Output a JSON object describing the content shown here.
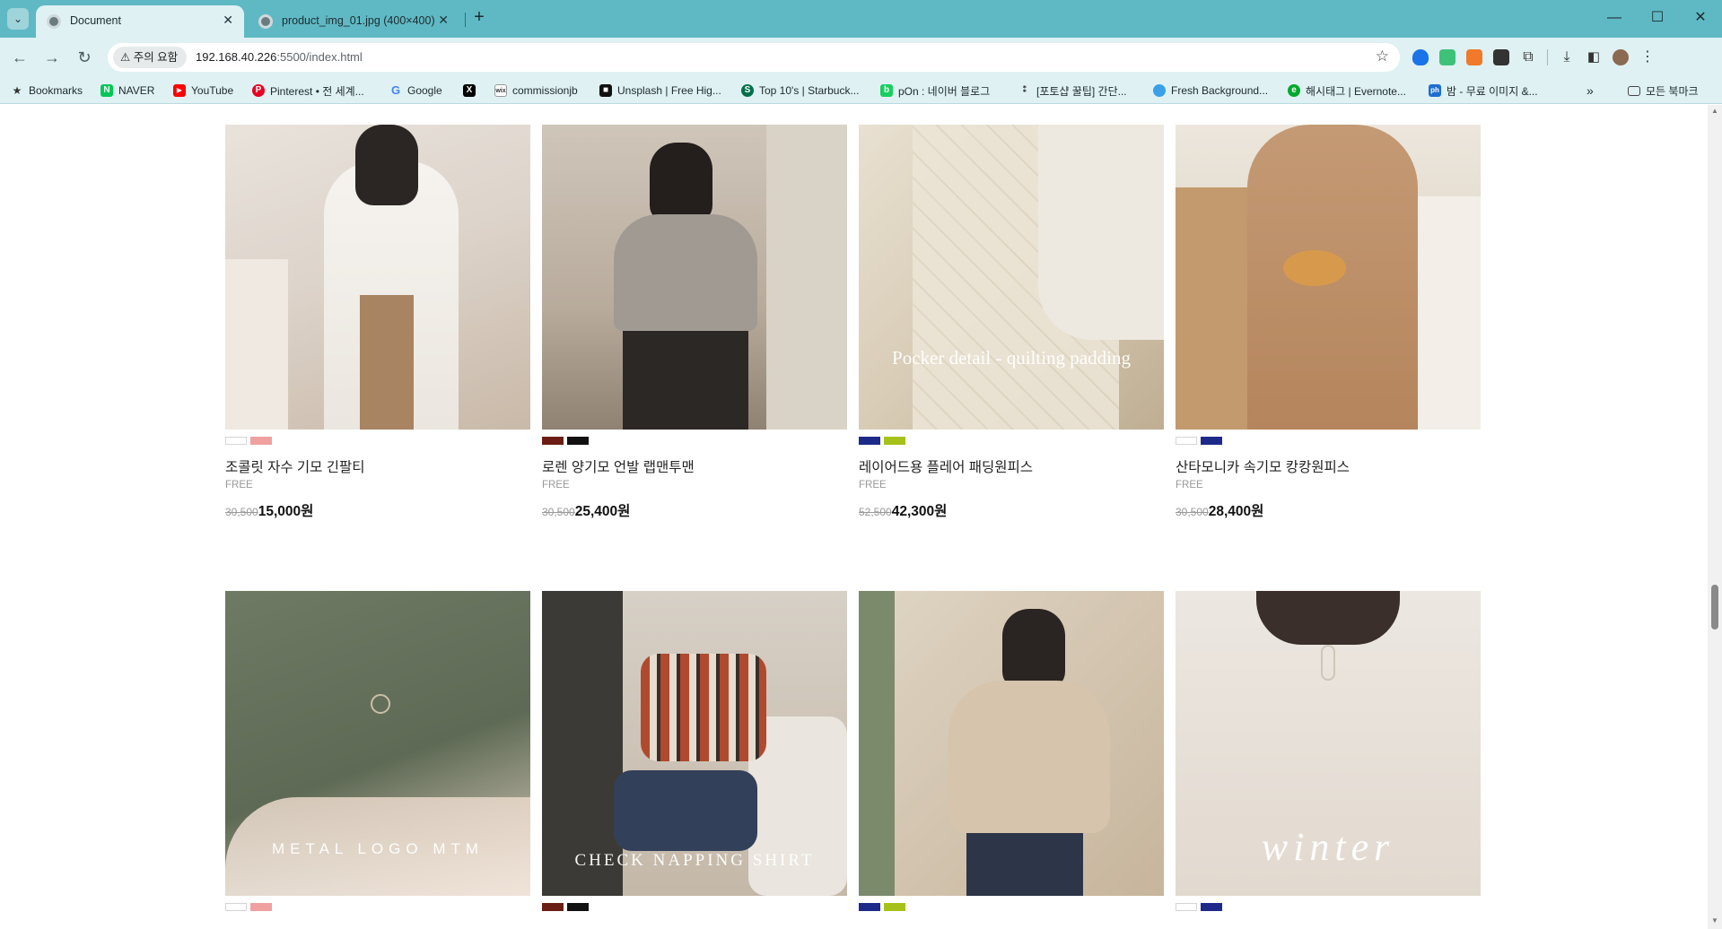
{
  "browser": {
    "tabs": [
      {
        "title": "Document",
        "active": true
      },
      {
        "title": "product_img_01.jpg (400×400)",
        "active": false
      }
    ],
    "security_label": "주의 요함",
    "url_host": "192.168.40.226",
    "url_rest": ":5500/index.html",
    "window_controls": [
      "—",
      "☐",
      "✕"
    ]
  },
  "bookmarks": [
    {
      "label": "Bookmarks",
      "icon": "star-icon",
      "color": "#333333"
    },
    {
      "label": "NAVER",
      "icon": "naver-icon",
      "color": "#03c75a"
    },
    {
      "label": "YouTube",
      "icon": "youtube-icon",
      "color": "#ff0000"
    },
    {
      "label": "Pinterest • 전 세계...",
      "icon": "pinterest-icon",
      "color": "#e60023"
    },
    {
      "label": "Google",
      "icon": "google-icon",
      "color": "#4285f4"
    },
    {
      "label": "",
      "icon": "x-icon",
      "color": "#000000"
    },
    {
      "label": "commissionjb",
      "icon": "wix-icon",
      "color": "#555555"
    },
    {
      "label": "Unsplash | Free Hig...",
      "icon": "unsplash-icon",
      "color": "#111111"
    },
    {
      "label": "Top 10's | Starbuck...",
      "icon": "starbucks-icon",
      "color": "#00704a"
    },
    {
      "label": "pOn : 네이버 블로그",
      "icon": "blog-icon",
      "color": "#19ce60"
    },
    {
      "label": "[포토샵 꿀팁] 간단...",
      "icon": "tips-icon",
      "color": "#222222"
    },
    {
      "label": "Fresh Background...",
      "icon": "fresh-icon",
      "color": "#3aa0e8"
    },
    {
      "label": "해시태그 | Evernote...",
      "icon": "evernote-icon",
      "color": "#00a82d"
    },
    {
      "label": "밤 - 무료 이미지 &...",
      "icon": "ph-icon",
      "color": "#1d6fd1"
    },
    {
      "label": "모든 북마크",
      "icon": "folder-icon",
      "color": "#444444"
    }
  ],
  "products": [
    {
      "name": "조콜릿 자수 기모 긴팔티",
      "size": "FREE",
      "old_price": "30,500",
      "price": "15,000원",
      "swatches": [
        "#ffffff",
        "#f0a0a0"
      ],
      "overlay": ""
    },
    {
      "name": "로렌 양기모 언발 랩맨투맨",
      "size": "FREE",
      "old_price": "30,500",
      "price": "25,400원",
      "swatches": [
        "#6b1f14",
        "#111111"
      ],
      "overlay": ""
    },
    {
      "name": "레이어드용 플레어 패딩원피스",
      "size": "FREE",
      "old_price": "52,500",
      "price": "42,300원",
      "swatches": [
        "#1d2a8a",
        "#a6c21a"
      ],
      "overlay": "Pocker detail - quilting padding"
    },
    {
      "name": "산타모니카 속기모 캉캉원피스",
      "size": "FREE",
      "old_price": "30,500",
      "price": "28,400원",
      "swatches": [
        "#ffffff",
        "#1d2a8a"
      ],
      "overlay": ""
    },
    {
      "name": "",
      "size": "",
      "old_price": "",
      "price": "",
      "swatches": [
        "#ffffff",
        "#f0a0a0"
      ],
      "overlay": "METAL LOGO MTM"
    },
    {
      "name": "",
      "size": "",
      "old_price": "",
      "price": "",
      "swatches": [
        "#6b1f14",
        "#111111"
      ],
      "overlay": "CHECK NAPPING SHIRT"
    },
    {
      "name": "",
      "size": "",
      "old_price": "",
      "price": "",
      "swatches": [
        "#1d2a8a",
        "#a6c21a"
      ],
      "overlay": ""
    },
    {
      "name": "",
      "size": "",
      "old_price": "",
      "price": "",
      "swatches": [
        "#ffffff",
        "#1d2a8a"
      ],
      "overlay": "winter"
    }
  ]
}
